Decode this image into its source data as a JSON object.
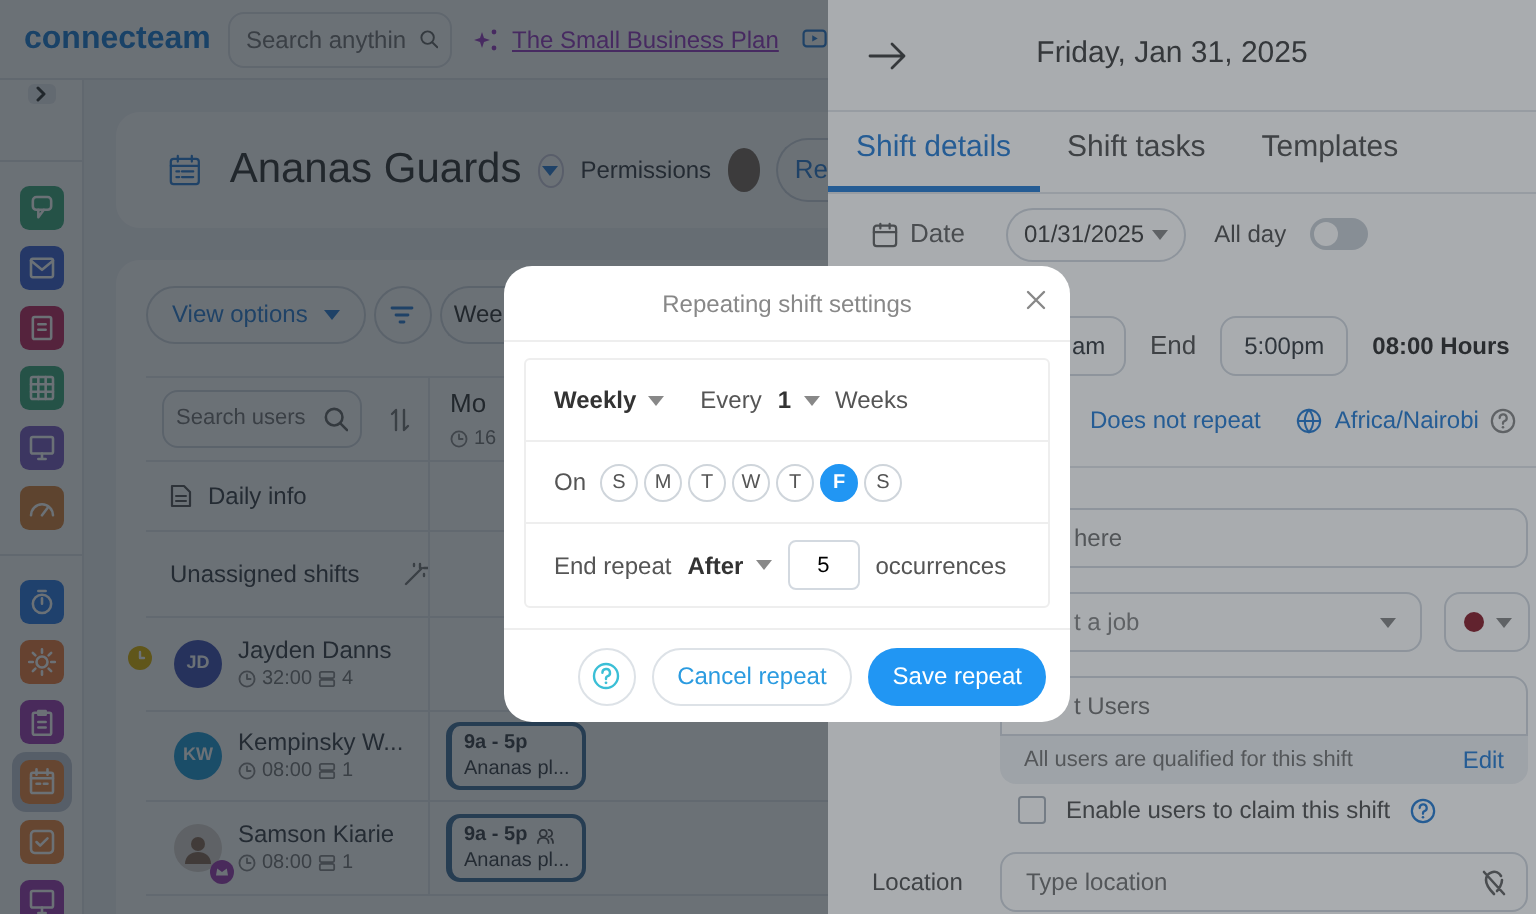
{
  "topbar": {
    "logo": "connecteam",
    "search": {
      "placeholder": "Search anythin"
    },
    "plan_link": "The Small Business Plan"
  },
  "sidebar": {
    "apps": [
      {
        "selected": false
      },
      {
        "selected": false
      },
      {
        "selected": false
      },
      {
        "selected": false
      },
      {
        "selected": false
      },
      {
        "selected": false
      }
    ],
    "tools": [
      {
        "selected": false
      },
      {
        "selected": false
      },
      {
        "selected": false
      },
      {
        "selected": true
      },
      {
        "selected": false
      },
      {
        "selected": false
      }
    ]
  },
  "page_header": {
    "title": "Ananas Guards",
    "permissions": "Permissions",
    "button_partial": "Re"
  },
  "toolbar": {
    "view_options": "View options",
    "week_partial": "Wee"
  },
  "schedule": {
    "search": {
      "placeholder": "Search users"
    },
    "day_header": {
      "label": "Mo",
      "time_partial": "16"
    },
    "daily_info": "Daily info",
    "unassigned": "Unassigned shifts",
    "users": [
      {
        "initials": "JD",
        "name": "Jayden Danns",
        "hours": "32:00",
        "shifts": "4",
        "photo": false,
        "alert": true,
        "admin": false
      },
      {
        "initials": "KW",
        "name": "Kempinsky W...",
        "hours": "08:00",
        "shifts": "1",
        "photo": false,
        "alert": false,
        "admin": false,
        "shift": {
          "time": "9a - 5p",
          "place": "Ananas pl...",
          "team": false
        }
      },
      {
        "name": "Samson Kiarie",
        "hours": "08:00",
        "shifts": "1",
        "photo": true,
        "alert": false,
        "admin": true,
        "shift": {
          "time": "9a - 5p",
          "place": "Ananas pl...",
          "team": true
        }
      }
    ]
  },
  "drawer": {
    "title": "Friday, Jan 31, 2025",
    "tabs": [
      {
        "label": "Shift details",
        "selected": true
      },
      {
        "label": "Shift tasks",
        "selected": false
      },
      {
        "label": "Templates",
        "selected": false
      }
    ],
    "date": {
      "label": "Date",
      "value": "01/31/2025"
    },
    "all_day": {
      "label": "All day",
      "on": false
    },
    "start_partial": "am",
    "end": {
      "label": "End",
      "value": "5:00pm"
    },
    "duration": "08:00 Hours",
    "repeat_link": "Does not repeat",
    "timezone": "Africa/Nairobi",
    "title_field": {
      "placeholder": "here"
    },
    "job_field": {
      "placeholder": "t a job"
    },
    "users_field": {
      "placeholder": "t Users"
    },
    "qualified_note": "All users are qualified for this shift",
    "edit_link": "Edit",
    "claim": {
      "label": "Enable users to claim this shift",
      "checked": false
    },
    "location": {
      "label": "Location",
      "placeholder": "Type location"
    }
  },
  "modal": {
    "title": "Repeating shift settings",
    "frequency": "Weekly",
    "every_label": "Every",
    "interval": "1",
    "unit": "Weeks",
    "on_label": "On",
    "days": [
      {
        "letter": "S",
        "selected": false
      },
      {
        "letter": "M",
        "selected": false
      },
      {
        "letter": "T",
        "selected": false
      },
      {
        "letter": "W",
        "selected": false
      },
      {
        "letter": "T",
        "selected": false
      },
      {
        "letter": "F",
        "selected": true
      },
      {
        "letter": "S",
        "selected": false
      }
    ],
    "end_label": "End repeat",
    "end_mode": "After",
    "occurrences": "5",
    "occurrences_label": "occurrences",
    "cancel": "Cancel repeat",
    "save": "Save repeat"
  }
}
